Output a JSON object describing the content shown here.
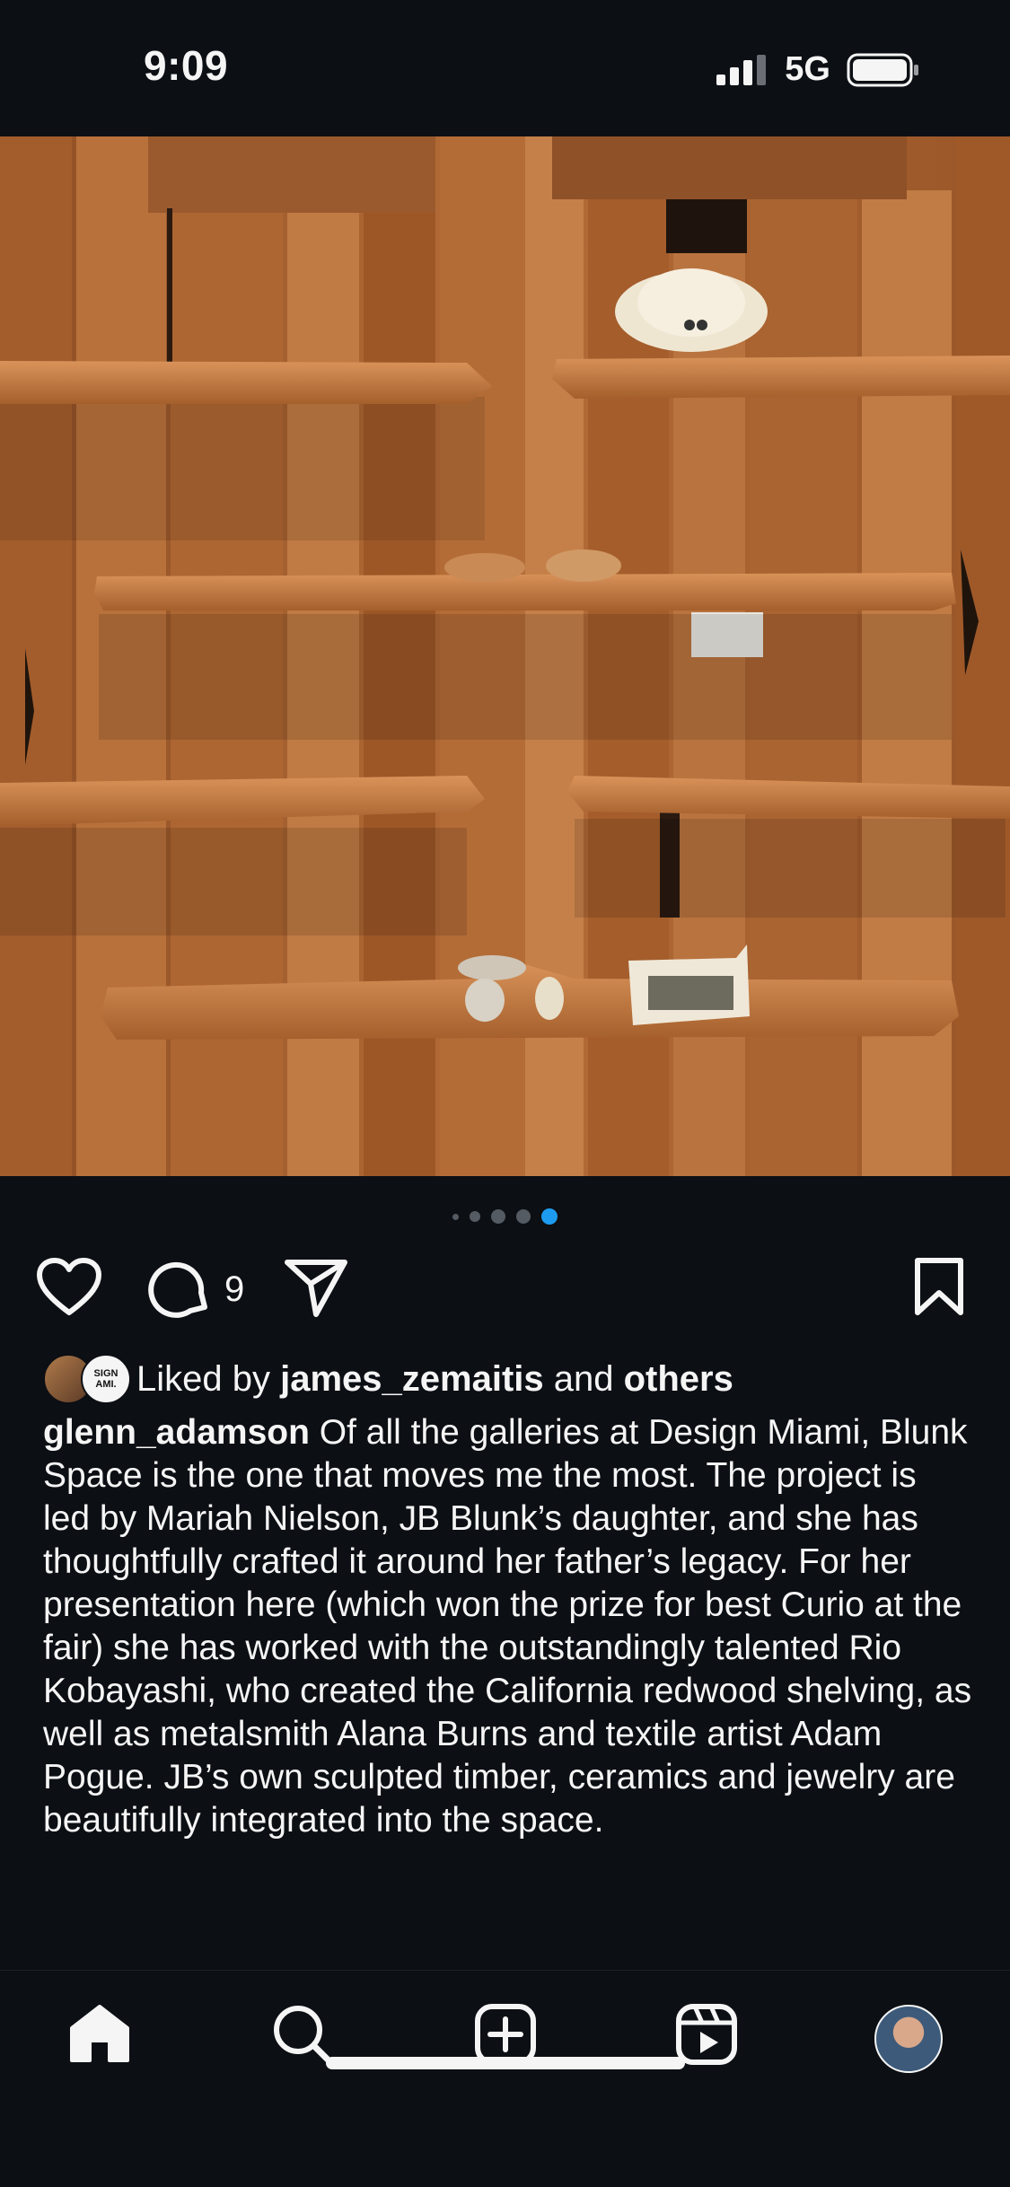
{
  "status": {
    "time": "9:09",
    "network": "5G"
  },
  "photo": {
    "description_icon": "image"
  },
  "carousel": {
    "total": 5,
    "active_index": 4
  },
  "actions": {
    "comment_count": "9"
  },
  "likes": {
    "prefix": "Liked by ",
    "user": "james_zemaitis",
    "middle": " and ",
    "others": "others",
    "avatar2_text": "SIGN AMI."
  },
  "caption": {
    "username": "glenn_adamson",
    "text": " Of all the galleries at Design Miami, Blunk Space is the one that moves me the most. The project is led by Mariah Nielson, JB Blunk’s daughter, and she has thoughtfully crafted it around her father’s legacy. For her presentation here (which won the prize for best Curio at the fair) she has worked with the outstandingly talented Rio Kobayashi, who created the California redwood shelving, as well as metalsmith Alana Burns and textile artist Adam Pogue. JB’s own sculpted timber, ceramics and jewelry are beautifully integrated into the space."
  },
  "colors": {
    "background": "#0c0f14",
    "accent": "#1d9bf0",
    "wood": "#b46a35"
  }
}
